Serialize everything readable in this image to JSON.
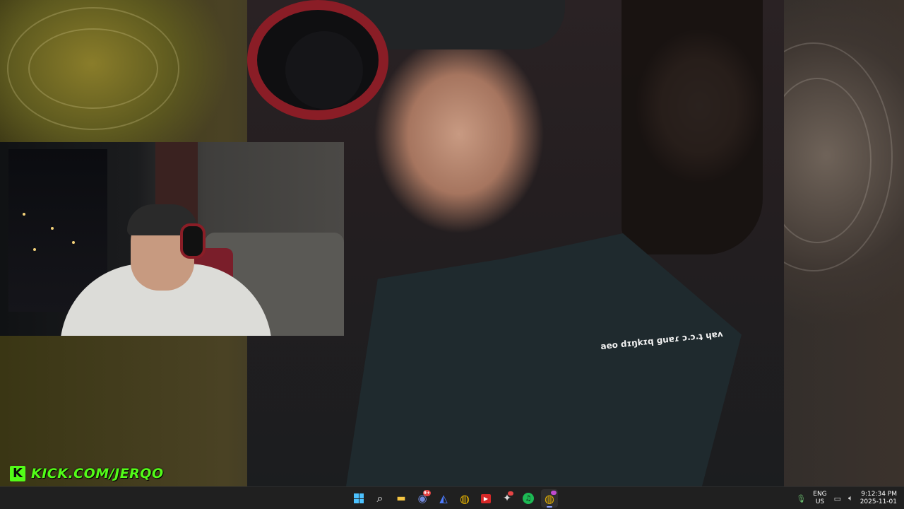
{
  "stream": {
    "caption": "aeo dɪŋkɪq ɡuɐɾ ɔ.ɔ.ʇ ɥɐʌ",
    "kick_handle": "KICK.COM/JERQO",
    "kick_glyph": "K"
  },
  "taskbar": {
    "apps": [
      {
        "name": "start-icon",
        "glyph": ""
      },
      {
        "name": "search-icon",
        "glyph": "⌕"
      },
      {
        "name": "file-explorer-icon",
        "glyph": "▬"
      },
      {
        "name": "discord-icon",
        "glyph": "◉",
        "badge": "9+"
      },
      {
        "name": "arc-browser-icon",
        "glyph": "◭"
      },
      {
        "name": "chrome-icon",
        "glyph": "◍"
      },
      {
        "name": "youtube-icon",
        "glyph": "▶"
      },
      {
        "name": "tool-icon",
        "glyph": "✦",
        "badge": ""
      },
      {
        "name": "spotify-icon",
        "glyph": "♫"
      },
      {
        "name": "chrome-profile-icon",
        "glyph": "◍",
        "badge": ""
      }
    ],
    "language_top": "ENG",
    "language_bottom": "US",
    "time": "9:12:34 PM",
    "date": "2025-11-01"
  }
}
